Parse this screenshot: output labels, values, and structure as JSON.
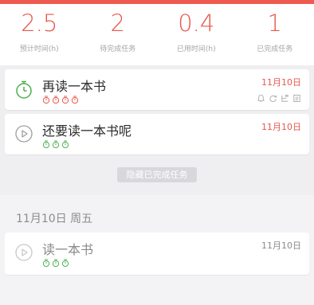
{
  "stats": [
    {
      "value": "2.5",
      "label": "预计时间(h)"
    },
    {
      "value": "2",
      "label": "待完成任务"
    },
    {
      "value": "0.4",
      "label": "已用时间(h)"
    },
    {
      "value": "1",
      "label": "已完成任务"
    }
  ],
  "tasks": [
    {
      "title": "再读一本书",
      "date": "11月10日",
      "status_icon": "stopwatch-icon",
      "pomodoros_done": 0,
      "pomodoros_total": 4,
      "pomodoro_color": "#e8574b",
      "tools": [
        "bell-icon",
        "repeat-icon",
        "subtask-icon",
        "note-icon"
      ]
    },
    {
      "title": "还要读一本书呢",
      "date": "11月10日",
      "status_icon": "play-icon",
      "pomodoros_done": 0,
      "pomodoros_total": 3,
      "pomodoro_color": "#4caf50"
    }
  ],
  "hide_completed_label": "隐藏已完成任务",
  "day_section": {
    "header": "11月10日 周五",
    "tasks": [
      {
        "title": "读一本书",
        "date": "11月10日",
        "status_icon": "play-icon",
        "pomodoros_done": 3,
        "pomodoros_total": 3,
        "pomodoro_color": "#4caf50"
      }
    ]
  },
  "colors": {
    "accent": "#e8574b",
    "green": "#4caf50",
    "background": "#efeff1"
  }
}
